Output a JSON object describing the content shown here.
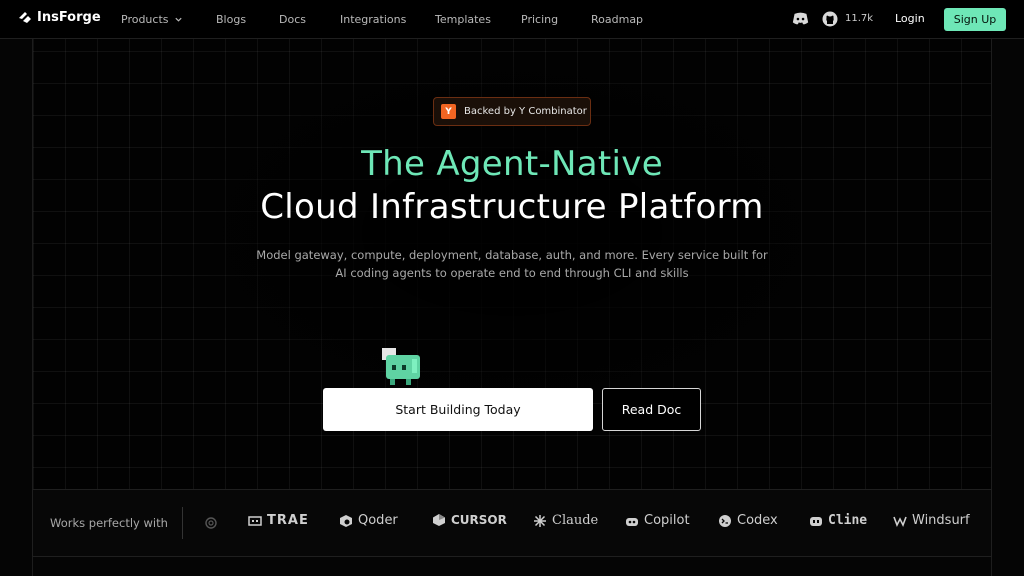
{
  "nav": {
    "logo_text": "InsForge",
    "links": [
      "Products",
      "Blogs",
      "Docs",
      "Integrations",
      "Templates",
      "Pricing",
      "Roadmap"
    ],
    "github_stars": "11.7k",
    "login_label": "Login",
    "signup_label": "Sign Up"
  },
  "hero": {
    "badge_icon_letter": "Y",
    "badge_text": "Backed by Y Combinator",
    "title_line1": "The Agent-Native",
    "title_line2": "Cloud Infrastructure Platform",
    "subtitle_line1": "Model gateway, compute, deployment, database, auth, and more. Every service built for",
    "subtitle_line2": "AI coding agents to operate end to end through CLI and skills",
    "primary_button": "Start Building Today",
    "secondary_button": "Read Doc"
  },
  "works_with": {
    "label": "Works perfectly with",
    "brands": [
      "TRAE",
      "Qoder",
      "CURSOR",
      "Claude",
      "Copilot",
      "Codex",
      "Cline",
      "Windsurf"
    ]
  },
  "colors": {
    "accent_green": "#6ee7b7",
    "badge_orange": "#f26522"
  }
}
